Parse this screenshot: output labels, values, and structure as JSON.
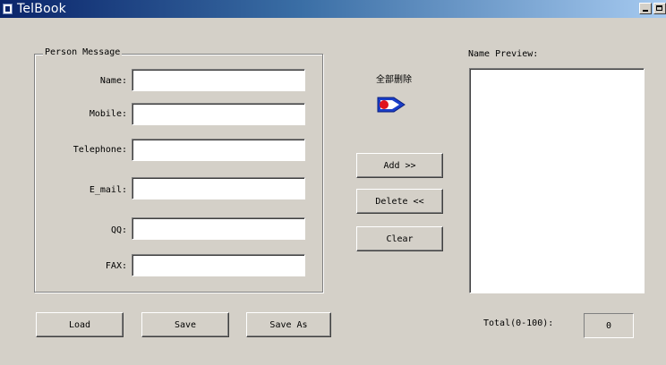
{
  "window": {
    "title": "TelBook"
  },
  "person": {
    "legend": "Person Message",
    "fields": [
      {
        "label": "Name:",
        "value": ""
      },
      {
        "label": "Mobile:",
        "value": ""
      },
      {
        "label": "Telephone:",
        "value": ""
      },
      {
        "label": "E_mail:",
        "value": ""
      },
      {
        "label": "QQ:",
        "value": ""
      },
      {
        "label": "FAX:",
        "value": ""
      }
    ]
  },
  "middle": {
    "chinese_label": "全部删除",
    "transfer_icon": "transfer-arrow-icon",
    "add_label": "Add >>",
    "delete_label": "Delete <<",
    "clear_label": "Clear"
  },
  "preview": {
    "label": "Name Preview:",
    "items": [],
    "total_label": "Total(0-100):",
    "total_value": "0"
  },
  "bottom": {
    "load_label": "Load",
    "save_label": "Save",
    "save_as_label": "Save As"
  }
}
